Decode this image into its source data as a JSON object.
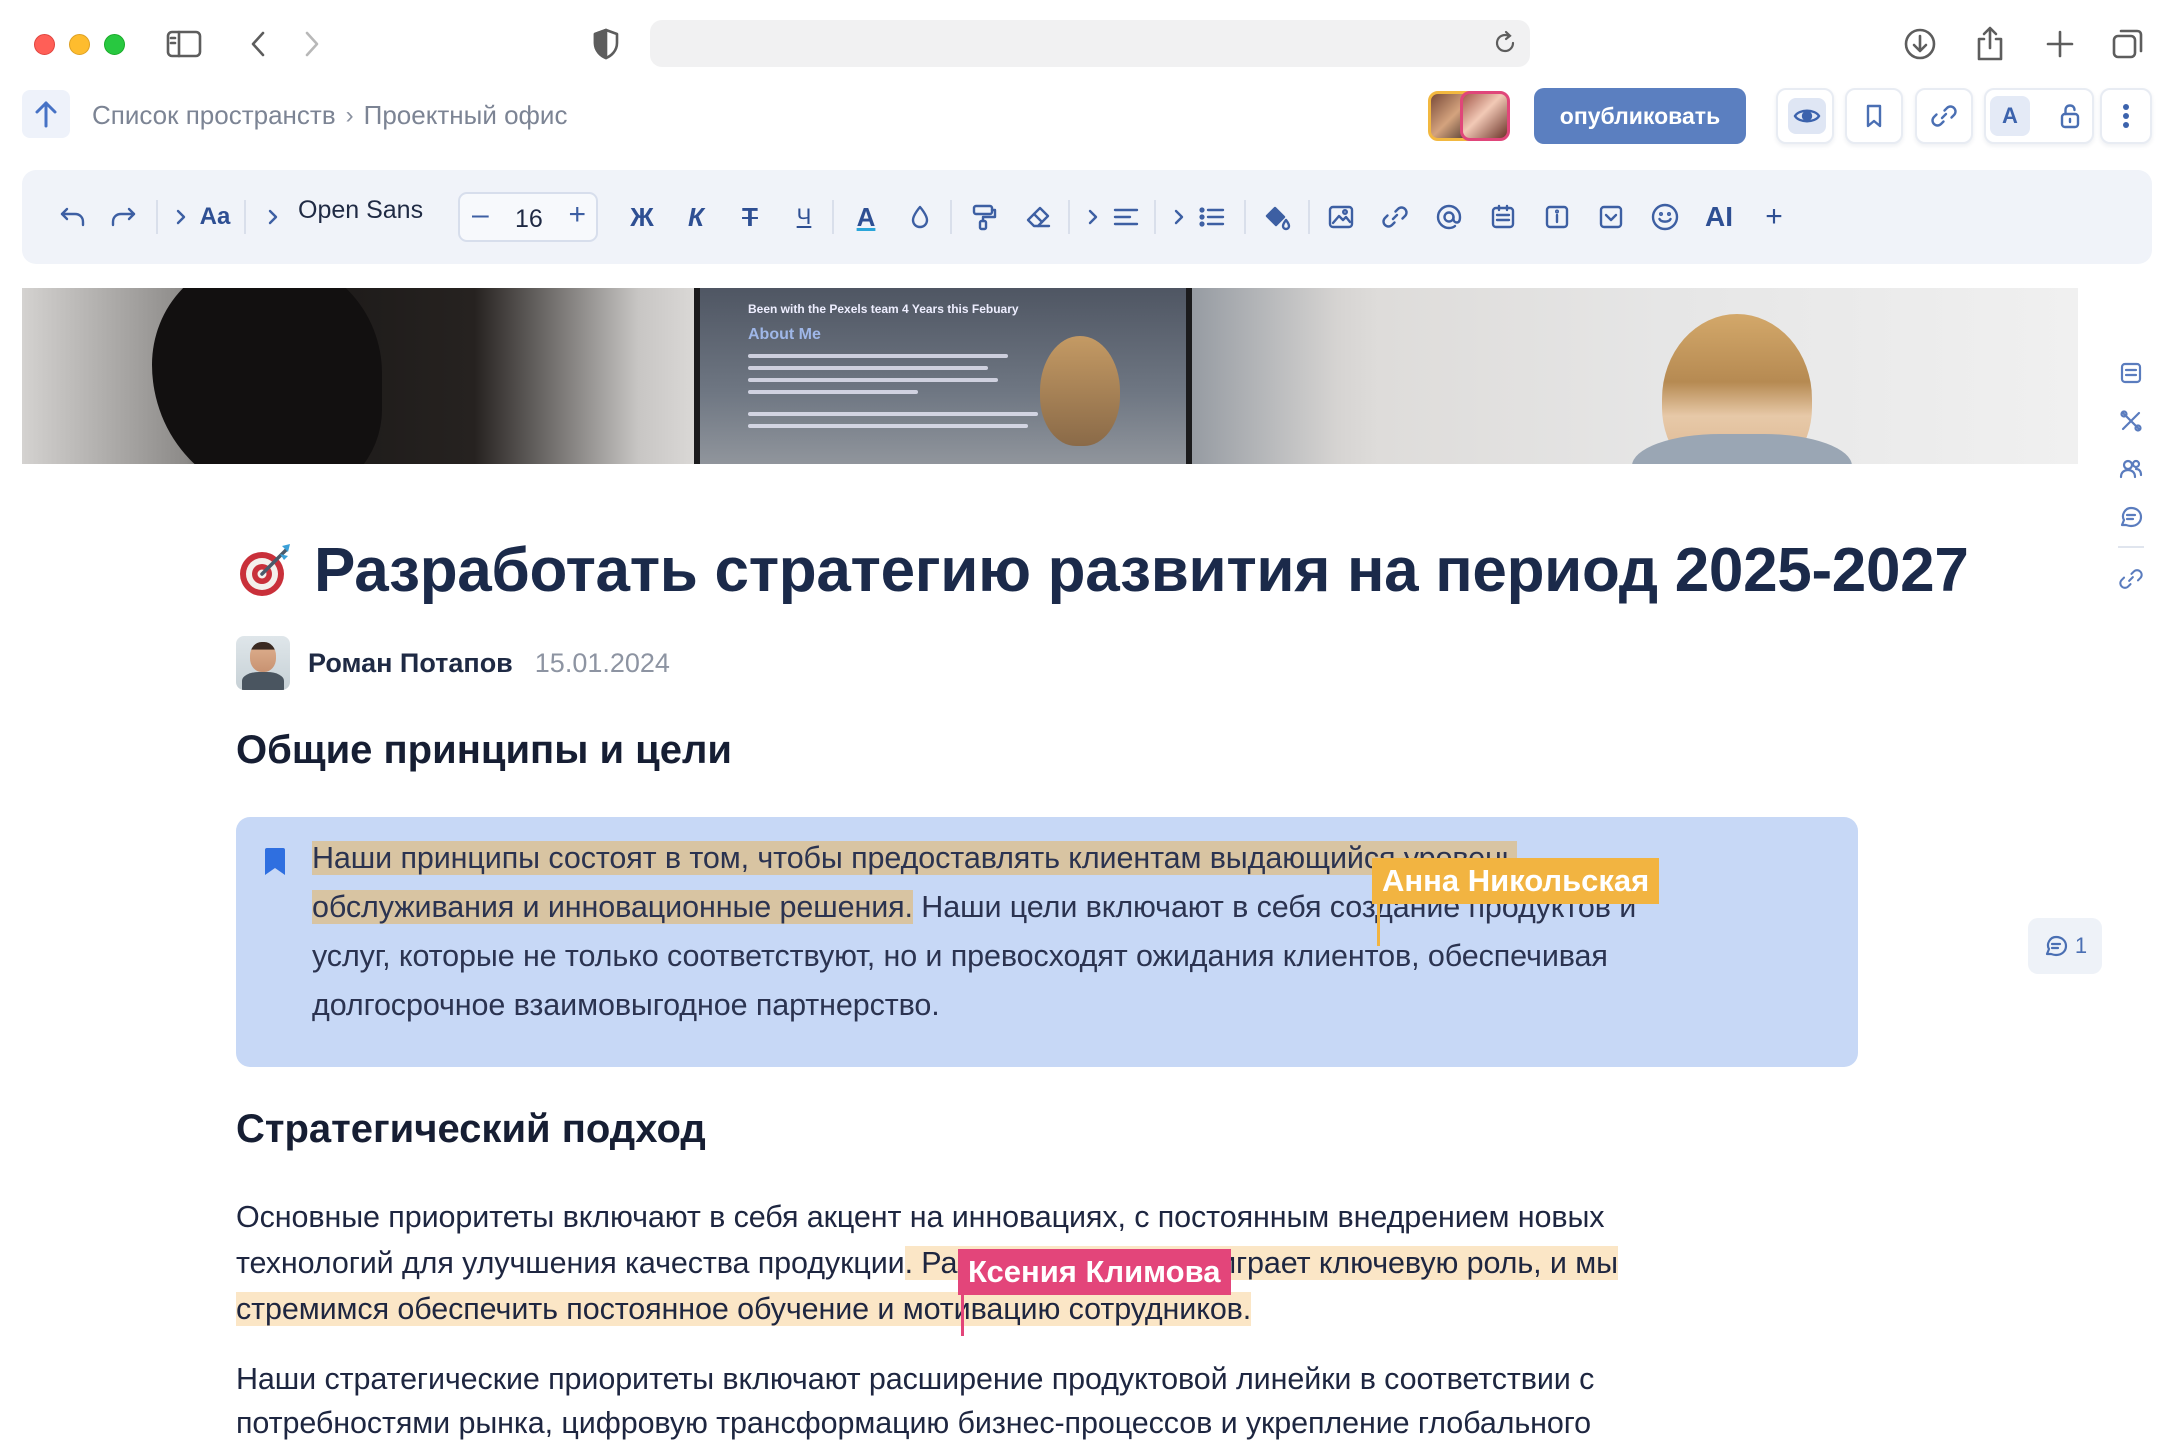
{
  "breadcrumb": {
    "items": [
      "Список пространств",
      "Проектный офис"
    ],
    "separator": "›"
  },
  "header": {
    "publish_label": "опубликовать",
    "font_letter": "A"
  },
  "toolbar": {
    "font_family": "Open Sans",
    "font_size": "16",
    "size_minus": "–",
    "size_plus": "+",
    "text_style_label": "Aa",
    "bold_label": "Ж",
    "italic_label": "К",
    "strike_label": "Т",
    "underline_label": "Ч",
    "color_label": "A",
    "ai_label": "AI",
    "more_label": "+"
  },
  "cover": {
    "screen_title": "Been with the Pexels team 4 Years this Febuary",
    "screen_heading": "About Me"
  },
  "document": {
    "title": "Разработать стратегию развития на период 2025-2027",
    "author": "Роман Потапов",
    "date": "15.01.2024",
    "section1_heading": "Общие принципы и цели",
    "callout_lines": [
      "Наши принципы состоят в том, чтобы предоставлять клиентам выда",
      "ющийся уровень",
      "обслуживания и инновационные решения.",
      " Наши цели включают в себя создание продуктов и",
      "услуг, которые не только соответствуют, но и превосходят ожидания клиентов, обеспечивая",
      "долгосрочное взаимовыгодное партнерство."
    ],
    "section2_heading": "Стратегический подход",
    "para1_lines": [
      "Основные приоритеты включают в себя акцент на инновациях, с постоянным внедрением новых",
      "технологий для улучшения качества продукции",
      ". Развитие персонала играет ключевую роль, и мы",
      "стремимся обеспечить постоянное обучение и",
      " мотивацию сотрудников."
    ],
    "para2_lines": [
      "Наши стратегические приоритеты включают расширение продуктовой линейки в соответствии с",
      "потребностями рынка, цифровую трансформацию бизнес-процессов и укрепление глобального"
    ]
  },
  "collaborators": {
    "anna": {
      "name": "Анна Никольская",
      "color": "#f2b441"
    },
    "ksenia": {
      "name": "Ксения Климова",
      "color": "#e3457a"
    }
  },
  "comments": {
    "count": "1"
  },
  "colors": {
    "accent": "#5b7fc0",
    "callout_bg": "#c7d8f6",
    "highlight_tan": "#d8c4a2",
    "highlight_peach": "#fbe6c6"
  }
}
